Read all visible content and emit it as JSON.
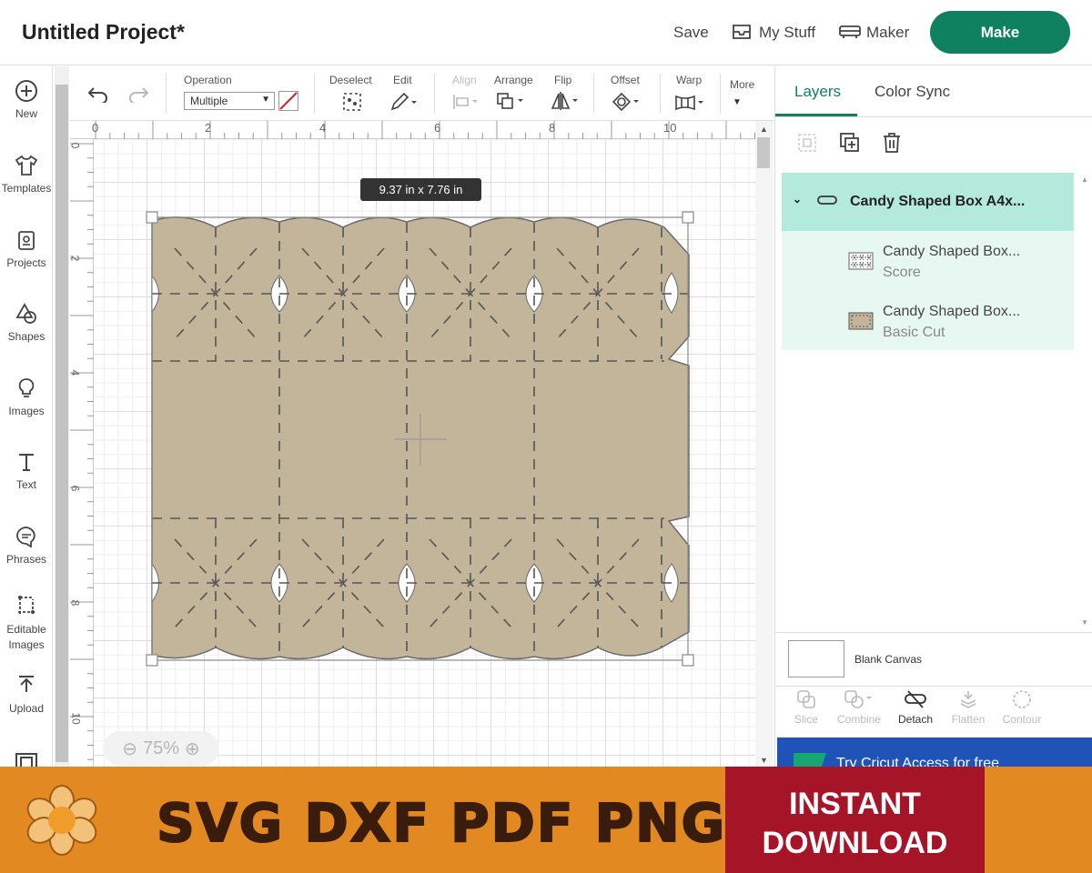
{
  "header": {
    "title": "Untitled Project*",
    "save": "Save",
    "my_stuff": "My Stuff",
    "maker": "Maker",
    "make": "Make"
  },
  "sidebar": {
    "items": [
      {
        "label": "New",
        "icon": "plus-circle-icon"
      },
      {
        "label": "Templates",
        "icon": "shirt-icon"
      },
      {
        "label": "Projects",
        "icon": "projects-icon"
      },
      {
        "label": "Shapes",
        "icon": "shapes-icon"
      },
      {
        "label": "Images",
        "icon": "lightbulb-icon"
      },
      {
        "label": "Text",
        "icon": "text-icon"
      },
      {
        "label": "Phrases",
        "icon": "speech-bubble-icon"
      },
      {
        "label": "Editable",
        "label2": "Images",
        "icon": "editable-images-icon"
      },
      {
        "label": "Upload",
        "icon": "upload-icon"
      }
    ]
  },
  "toolbar": {
    "operation_label": "Operation",
    "operation_value": "Multiple",
    "deselect": "Deselect",
    "edit": "Edit",
    "align": "Align",
    "arrange": "Arrange",
    "flip": "Flip",
    "offset": "Offset",
    "warp": "Warp",
    "more": "More"
  },
  "rulers": {
    "top": [
      "0",
      "2",
      "4",
      "6",
      "8",
      "10"
    ],
    "left": [
      "0",
      "2",
      "4",
      "6",
      "8",
      "10"
    ]
  },
  "canvas": {
    "dimensions": "9.37  in x 7.76  in",
    "zoom": "75%",
    "fill_color": "#c2b59a"
  },
  "panel": {
    "tabs": [
      "Layers",
      "Color Sync"
    ],
    "group_name": "Candy Shaped Box A4x...",
    "layers": [
      {
        "name": "Candy Shaped Box...",
        "type": "Score"
      },
      {
        "name": "Candy Shaped Box...",
        "type": "Basic Cut"
      }
    ],
    "blank_canvas": "Blank Canvas",
    "bottom_tools": [
      "Slice",
      "Combine",
      "Detach",
      "Flatten",
      "Contour"
    ],
    "access": "Try Cricut Access for free"
  },
  "banner": {
    "formats": "SVG DXF PDF PNG",
    "instant": "INSTANT",
    "download": "DOWNLOAD"
  },
  "colors": {
    "brand_green": "#0f8060",
    "layer_highlight": "#b3eadb",
    "banner_orange": "#e28a21",
    "banner_red": "#a51427"
  }
}
